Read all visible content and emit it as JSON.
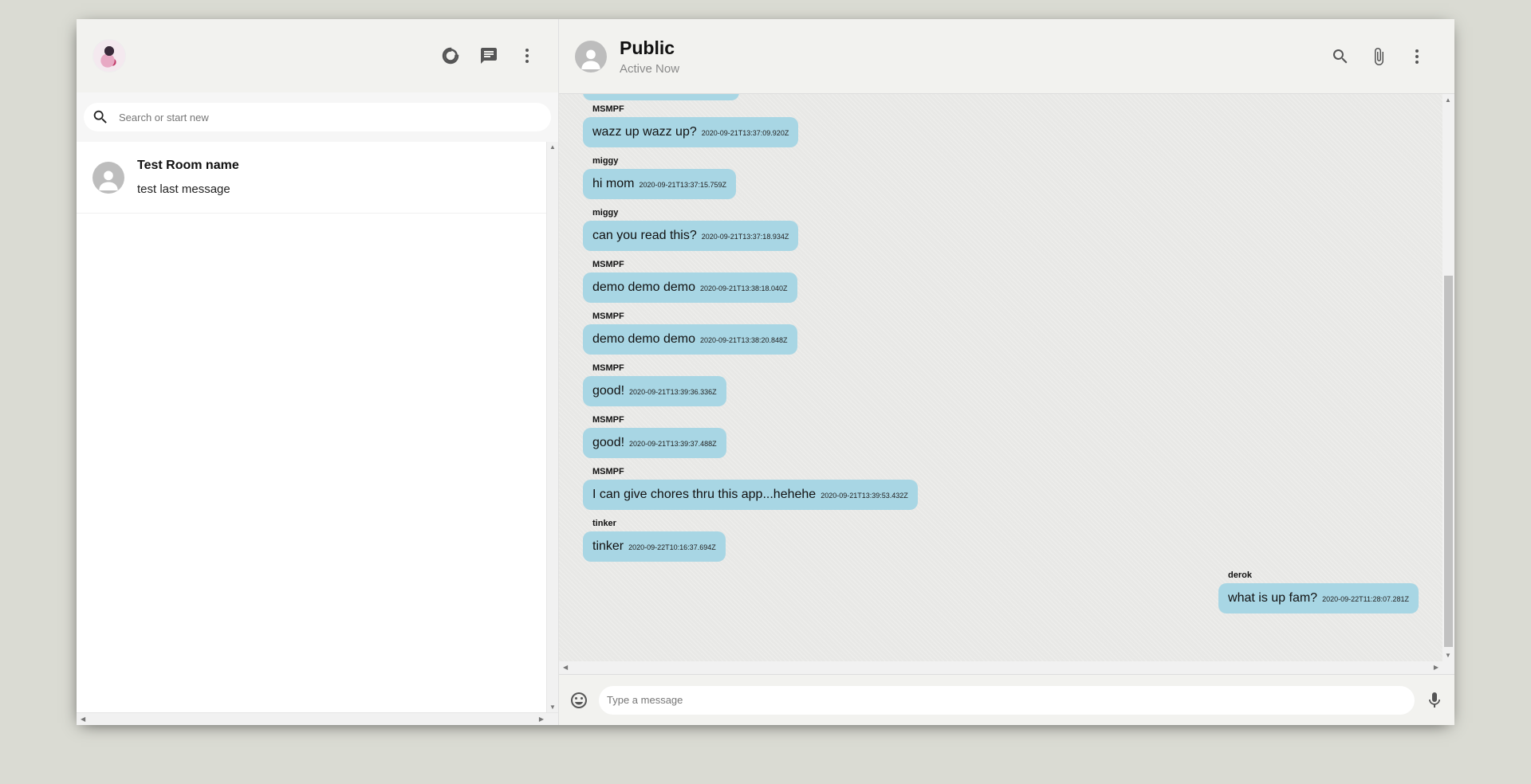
{
  "sidebar": {
    "search_placeholder": "Search or start new",
    "chats": [
      {
        "name": "Test Room name",
        "last_message": "test last message"
      }
    ]
  },
  "chat": {
    "title": "Public",
    "status": "Active Now",
    "input_placeholder": "Type a message",
    "messages": [
      {
        "name": "MSMPF",
        "text": "wazz up wazz up?",
        "timestamp": "2020-09-21T13:37:09.920Z",
        "mine": false
      },
      {
        "name": "miggy",
        "text": "hi mom",
        "timestamp": "2020-09-21T13:37:15.759Z",
        "mine": false
      },
      {
        "name": "miggy",
        "text": "can you read this?",
        "timestamp": "2020-09-21T13:37:18.934Z",
        "mine": false
      },
      {
        "name": "MSMPF",
        "text": "demo demo demo",
        "timestamp": "2020-09-21T13:38:18.040Z",
        "mine": false
      },
      {
        "name": "MSMPF",
        "text": "demo demo demo",
        "timestamp": "2020-09-21T13:38:20.848Z",
        "mine": false
      },
      {
        "name": "MSMPF",
        "text": "good!",
        "timestamp": "2020-09-21T13:39:36.336Z",
        "mine": false
      },
      {
        "name": "MSMPF",
        "text": "good!",
        "timestamp": "2020-09-21T13:39:37.488Z",
        "mine": false
      },
      {
        "name": "MSMPF",
        "text": "I can give chores thru this app...hehehe",
        "timestamp": "2020-09-21T13:39:53.432Z",
        "mine": false
      },
      {
        "name": "tinker",
        "text": "tinker",
        "timestamp": "2020-09-22T10:16:37.694Z",
        "mine": false
      },
      {
        "name": "derok",
        "text": "what is up fam?",
        "timestamp": "2020-09-22T11:28:07.281Z",
        "mine": true
      }
    ]
  },
  "icons": {
    "status": "circle-notch-icon",
    "new_chat": "chat-icon",
    "menu": "more-vert-icon",
    "search": "search-icon",
    "attach": "paperclip-icon",
    "emoji": "emoji-icon",
    "mic": "mic-icon"
  },
  "colors": {
    "bubble": "#a8d6e4",
    "background": "#dadbd3"
  }
}
